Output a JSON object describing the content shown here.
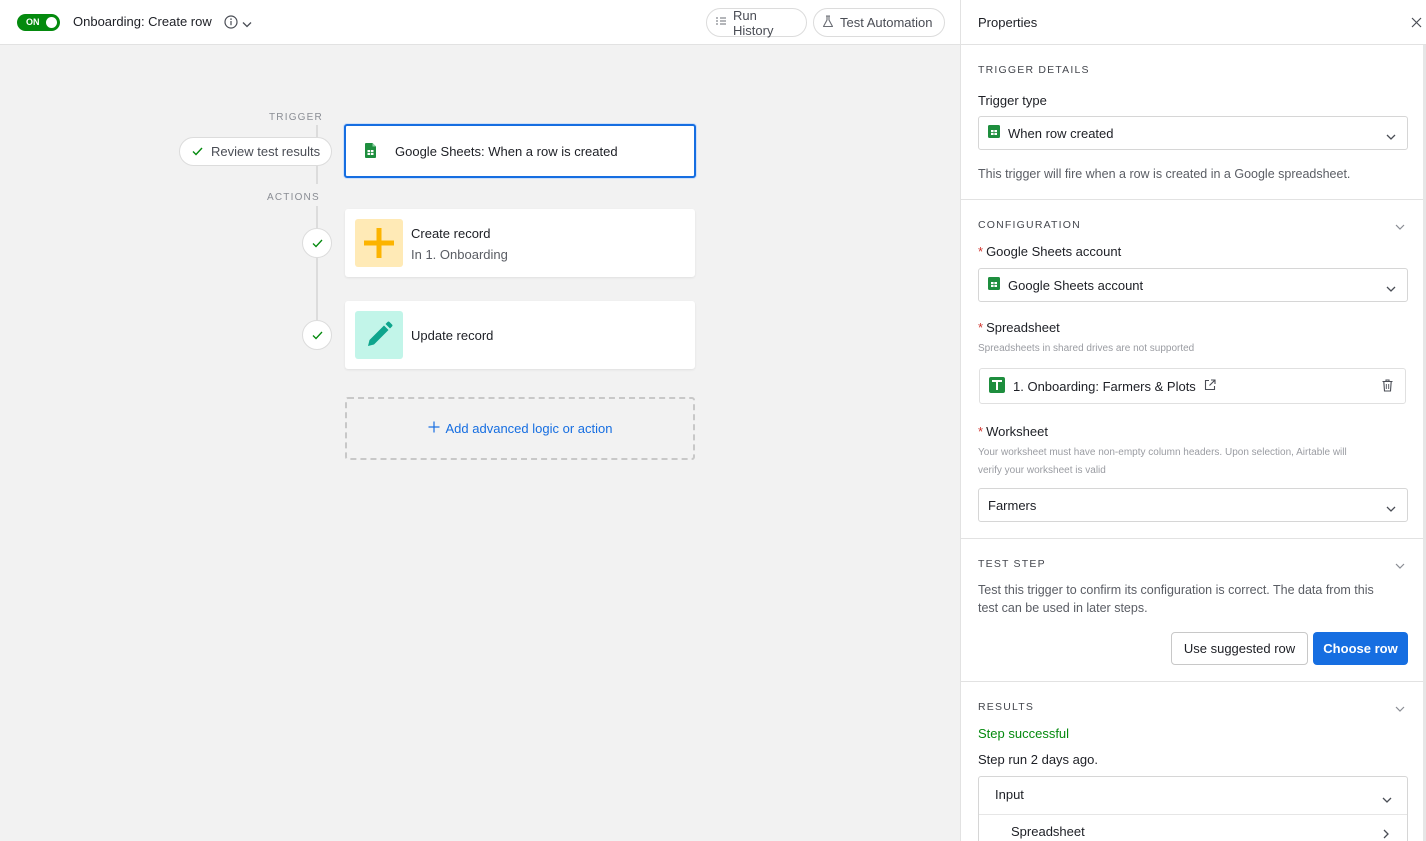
{
  "header": {
    "toggle_label": "ON",
    "title": "Onboarding: Create row",
    "run_history_label": "Run History",
    "test_automation_label": "Test Automation"
  },
  "canvas": {
    "trigger_label": "TRIGGER",
    "actions_label": "ACTIONS",
    "review_label": "Review test results",
    "trigger_card_label": "Google Sheets: When a row is created",
    "actions": [
      {
        "name": "Create record",
        "sub": "In 1. Onboarding"
      },
      {
        "name": "Update record",
        "sub": ""
      }
    ],
    "add_label": "Add advanced logic or action"
  },
  "panel": {
    "title": "Properties",
    "trigger_details": {
      "heading": "TRIGGER DETAILS",
      "trigger_type_label": "Trigger type",
      "trigger_type_value": "When row created",
      "description": "This trigger will fire when a row is created in a Google spreadsheet."
    },
    "configuration": {
      "heading": "CONFIGURATION",
      "account_label": "Google Sheets account",
      "account_value": "Google Sheets account",
      "spreadsheet_label": "Spreadsheet",
      "spreadsheet_hint": "Spreadsheets in shared drives are not supported",
      "spreadsheet_value": "1. Onboarding: Farmers & Plots",
      "worksheet_label": "Worksheet",
      "worksheet_hint_1": "Your worksheet must have non-empty column headers. Upon selection, Airtable will",
      "worksheet_hint_2": "verify your worksheet is valid",
      "worksheet_value": "Farmers"
    },
    "test_step": {
      "heading": "TEST STEP",
      "description_1": "Test this trigger to confirm its configuration is correct. The data from this",
      "description_2": "test can be used in later steps.",
      "suggested_label": "Use suggested row",
      "choose_label": "Choose row"
    },
    "results": {
      "heading": "RESULTS",
      "status": "Step successful",
      "run_time": "Step run 2 days ago.",
      "input_label": "Input",
      "spreadsheet_label": "Spreadsheet"
    }
  },
  "colors": {
    "accent": "#166ee1",
    "toggle_on": "#048a0e",
    "success": "#048a0e",
    "sheets_green": "#1e8e3e",
    "create_tile": "#ffeab6",
    "create_plus": "#fcb400",
    "update_tile": "#c2f5e9",
    "update_pencil": "#0ea58d"
  }
}
